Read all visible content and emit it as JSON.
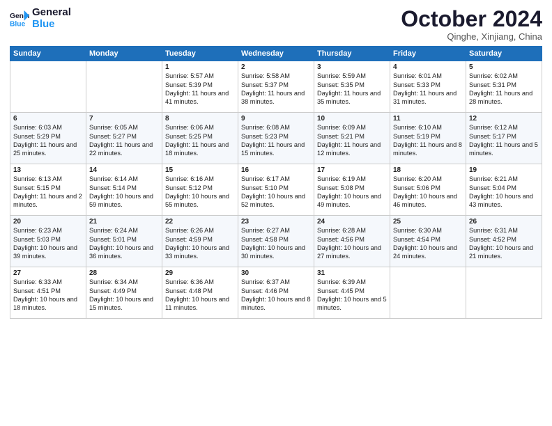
{
  "header": {
    "logo_general": "General",
    "logo_blue": "Blue",
    "month": "October 2024",
    "location": "Qinghe, Xinjiang, China"
  },
  "days_of_week": [
    "Sunday",
    "Monday",
    "Tuesday",
    "Wednesday",
    "Thursday",
    "Friday",
    "Saturday"
  ],
  "weeks": [
    [
      {
        "day": "",
        "content": ""
      },
      {
        "day": "",
        "content": ""
      },
      {
        "day": "1",
        "content": "Sunrise: 5:57 AM\nSunset: 5:39 PM\nDaylight: 11 hours and 41 minutes."
      },
      {
        "day": "2",
        "content": "Sunrise: 5:58 AM\nSunset: 5:37 PM\nDaylight: 11 hours and 38 minutes."
      },
      {
        "day": "3",
        "content": "Sunrise: 5:59 AM\nSunset: 5:35 PM\nDaylight: 11 hours and 35 minutes."
      },
      {
        "day": "4",
        "content": "Sunrise: 6:01 AM\nSunset: 5:33 PM\nDaylight: 11 hours and 31 minutes."
      },
      {
        "day": "5",
        "content": "Sunrise: 6:02 AM\nSunset: 5:31 PM\nDaylight: 11 hours and 28 minutes."
      }
    ],
    [
      {
        "day": "6",
        "content": "Sunrise: 6:03 AM\nSunset: 5:29 PM\nDaylight: 11 hours and 25 minutes."
      },
      {
        "day": "7",
        "content": "Sunrise: 6:05 AM\nSunset: 5:27 PM\nDaylight: 11 hours and 22 minutes."
      },
      {
        "day": "8",
        "content": "Sunrise: 6:06 AM\nSunset: 5:25 PM\nDaylight: 11 hours and 18 minutes."
      },
      {
        "day": "9",
        "content": "Sunrise: 6:08 AM\nSunset: 5:23 PM\nDaylight: 11 hours and 15 minutes."
      },
      {
        "day": "10",
        "content": "Sunrise: 6:09 AM\nSunset: 5:21 PM\nDaylight: 11 hours and 12 minutes."
      },
      {
        "day": "11",
        "content": "Sunrise: 6:10 AM\nSunset: 5:19 PM\nDaylight: 11 hours and 8 minutes."
      },
      {
        "day": "12",
        "content": "Sunrise: 6:12 AM\nSunset: 5:17 PM\nDaylight: 11 hours and 5 minutes."
      }
    ],
    [
      {
        "day": "13",
        "content": "Sunrise: 6:13 AM\nSunset: 5:15 PM\nDaylight: 11 hours and 2 minutes."
      },
      {
        "day": "14",
        "content": "Sunrise: 6:14 AM\nSunset: 5:14 PM\nDaylight: 10 hours and 59 minutes."
      },
      {
        "day": "15",
        "content": "Sunrise: 6:16 AM\nSunset: 5:12 PM\nDaylight: 10 hours and 55 minutes."
      },
      {
        "day": "16",
        "content": "Sunrise: 6:17 AM\nSunset: 5:10 PM\nDaylight: 10 hours and 52 minutes."
      },
      {
        "day": "17",
        "content": "Sunrise: 6:19 AM\nSunset: 5:08 PM\nDaylight: 10 hours and 49 minutes."
      },
      {
        "day": "18",
        "content": "Sunrise: 6:20 AM\nSunset: 5:06 PM\nDaylight: 10 hours and 46 minutes."
      },
      {
        "day": "19",
        "content": "Sunrise: 6:21 AM\nSunset: 5:04 PM\nDaylight: 10 hours and 43 minutes."
      }
    ],
    [
      {
        "day": "20",
        "content": "Sunrise: 6:23 AM\nSunset: 5:03 PM\nDaylight: 10 hours and 39 minutes."
      },
      {
        "day": "21",
        "content": "Sunrise: 6:24 AM\nSunset: 5:01 PM\nDaylight: 10 hours and 36 minutes."
      },
      {
        "day": "22",
        "content": "Sunrise: 6:26 AM\nSunset: 4:59 PM\nDaylight: 10 hours and 33 minutes."
      },
      {
        "day": "23",
        "content": "Sunrise: 6:27 AM\nSunset: 4:58 PM\nDaylight: 10 hours and 30 minutes."
      },
      {
        "day": "24",
        "content": "Sunrise: 6:28 AM\nSunset: 4:56 PM\nDaylight: 10 hours and 27 minutes."
      },
      {
        "day": "25",
        "content": "Sunrise: 6:30 AM\nSunset: 4:54 PM\nDaylight: 10 hours and 24 minutes."
      },
      {
        "day": "26",
        "content": "Sunrise: 6:31 AM\nSunset: 4:52 PM\nDaylight: 10 hours and 21 minutes."
      }
    ],
    [
      {
        "day": "27",
        "content": "Sunrise: 6:33 AM\nSunset: 4:51 PM\nDaylight: 10 hours and 18 minutes."
      },
      {
        "day": "28",
        "content": "Sunrise: 6:34 AM\nSunset: 4:49 PM\nDaylight: 10 hours and 15 minutes."
      },
      {
        "day": "29",
        "content": "Sunrise: 6:36 AM\nSunset: 4:48 PM\nDaylight: 10 hours and 11 minutes."
      },
      {
        "day": "30",
        "content": "Sunrise: 6:37 AM\nSunset: 4:46 PM\nDaylight: 10 hours and 8 minutes."
      },
      {
        "day": "31",
        "content": "Sunrise: 6:39 AM\nSunset: 4:45 PM\nDaylight: 10 hours and 5 minutes."
      },
      {
        "day": "",
        "content": ""
      },
      {
        "day": "",
        "content": ""
      }
    ]
  ]
}
